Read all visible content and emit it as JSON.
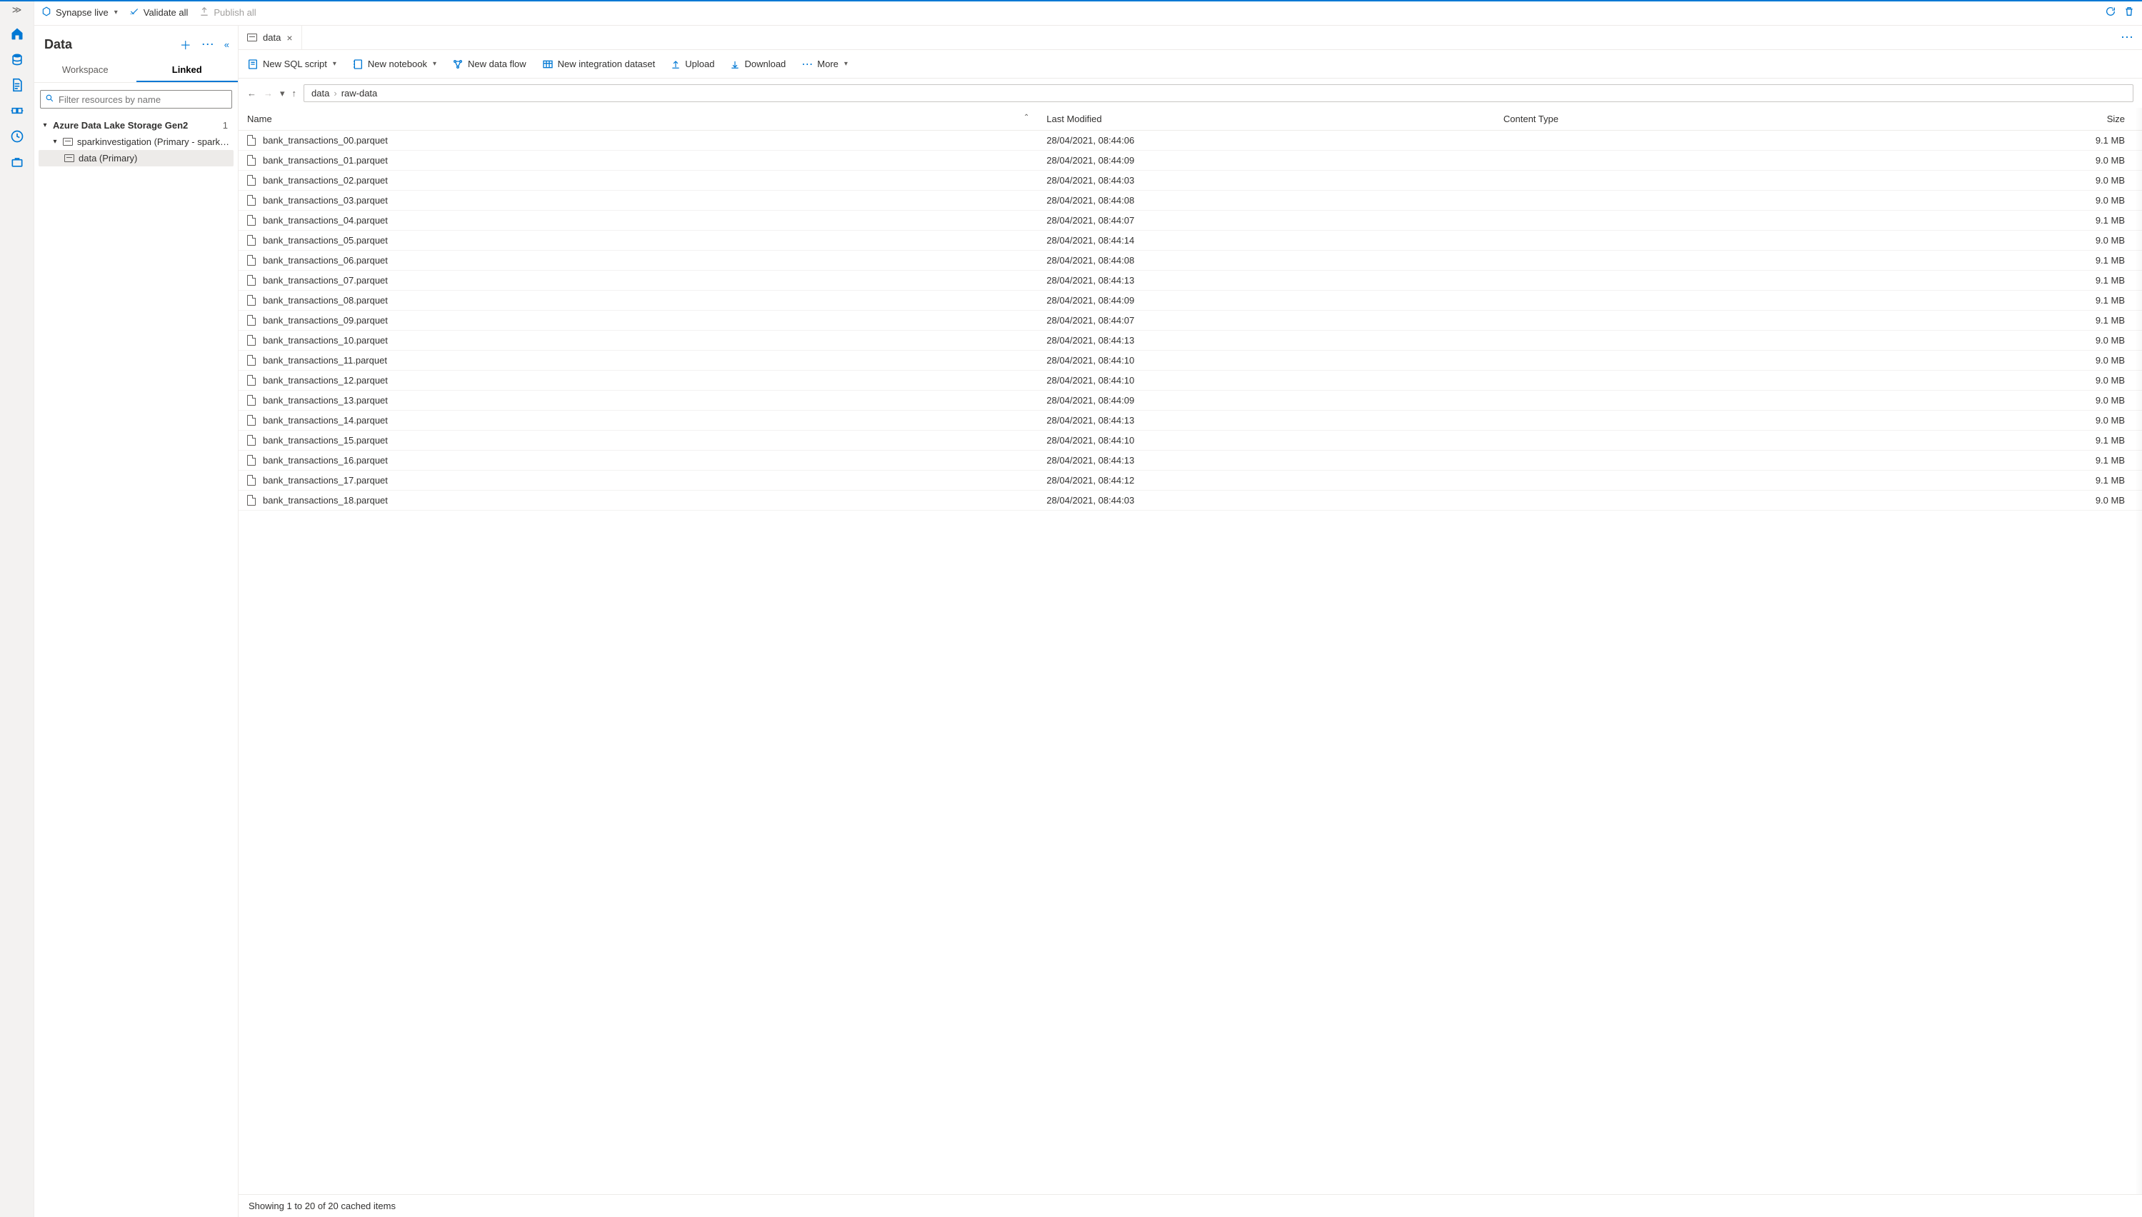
{
  "topbar": {
    "live_label": "Synapse live",
    "validate_label": "Validate all",
    "publish_label": "Publish all"
  },
  "panel": {
    "title": "Data",
    "tabs": {
      "workspace": "Workspace",
      "linked": "Linked"
    },
    "filter_placeholder": "Filter resources by name",
    "tree": {
      "root": "Azure Data Lake Storage Gen2",
      "root_count": "1",
      "account": "sparkinvestigation (Primary - sparki…",
      "container": "data (Primary)"
    }
  },
  "filetab": {
    "label": "data"
  },
  "toolbar": {
    "sql": "New SQL script",
    "notebook": "New notebook",
    "dataflow": "New data flow",
    "dataset": "New integration dataset",
    "upload": "Upload",
    "download": "Download",
    "more": "More"
  },
  "breadcrumb": {
    "root": "data",
    "child": "raw-data"
  },
  "columns": {
    "name": "Name",
    "modified": "Last Modified",
    "type": "Content Type",
    "size": "Size"
  },
  "files": [
    {
      "name": "bank_transactions_00.parquet",
      "modified": "28/04/2021, 08:44:06",
      "type": "",
      "size": "9.1 MB"
    },
    {
      "name": "bank_transactions_01.parquet",
      "modified": "28/04/2021, 08:44:09",
      "type": "",
      "size": "9.0 MB"
    },
    {
      "name": "bank_transactions_02.parquet",
      "modified": "28/04/2021, 08:44:03",
      "type": "",
      "size": "9.0 MB"
    },
    {
      "name": "bank_transactions_03.parquet",
      "modified": "28/04/2021, 08:44:08",
      "type": "",
      "size": "9.0 MB"
    },
    {
      "name": "bank_transactions_04.parquet",
      "modified": "28/04/2021, 08:44:07",
      "type": "",
      "size": "9.1 MB"
    },
    {
      "name": "bank_transactions_05.parquet",
      "modified": "28/04/2021, 08:44:14",
      "type": "",
      "size": "9.0 MB"
    },
    {
      "name": "bank_transactions_06.parquet",
      "modified": "28/04/2021, 08:44:08",
      "type": "",
      "size": "9.1 MB"
    },
    {
      "name": "bank_transactions_07.parquet",
      "modified": "28/04/2021, 08:44:13",
      "type": "",
      "size": "9.1 MB"
    },
    {
      "name": "bank_transactions_08.parquet",
      "modified": "28/04/2021, 08:44:09",
      "type": "",
      "size": "9.1 MB"
    },
    {
      "name": "bank_transactions_09.parquet",
      "modified": "28/04/2021, 08:44:07",
      "type": "",
      "size": "9.1 MB"
    },
    {
      "name": "bank_transactions_10.parquet",
      "modified": "28/04/2021, 08:44:13",
      "type": "",
      "size": "9.0 MB"
    },
    {
      "name": "bank_transactions_11.parquet",
      "modified": "28/04/2021, 08:44:10",
      "type": "",
      "size": "9.0 MB"
    },
    {
      "name": "bank_transactions_12.parquet",
      "modified": "28/04/2021, 08:44:10",
      "type": "",
      "size": "9.0 MB"
    },
    {
      "name": "bank_transactions_13.parquet",
      "modified": "28/04/2021, 08:44:09",
      "type": "",
      "size": "9.0 MB"
    },
    {
      "name": "bank_transactions_14.parquet",
      "modified": "28/04/2021, 08:44:13",
      "type": "",
      "size": "9.0 MB"
    },
    {
      "name": "bank_transactions_15.parquet",
      "modified": "28/04/2021, 08:44:10",
      "type": "",
      "size": "9.1 MB"
    },
    {
      "name": "bank_transactions_16.parquet",
      "modified": "28/04/2021, 08:44:13",
      "type": "",
      "size": "9.1 MB"
    },
    {
      "name": "bank_transactions_17.parquet",
      "modified": "28/04/2021, 08:44:12",
      "type": "",
      "size": "9.1 MB"
    },
    {
      "name": "bank_transactions_18.parquet",
      "modified": "28/04/2021, 08:44:03",
      "type": "",
      "size": "9.0 MB"
    }
  ],
  "status": "Showing 1 to 20 of 20 cached items"
}
